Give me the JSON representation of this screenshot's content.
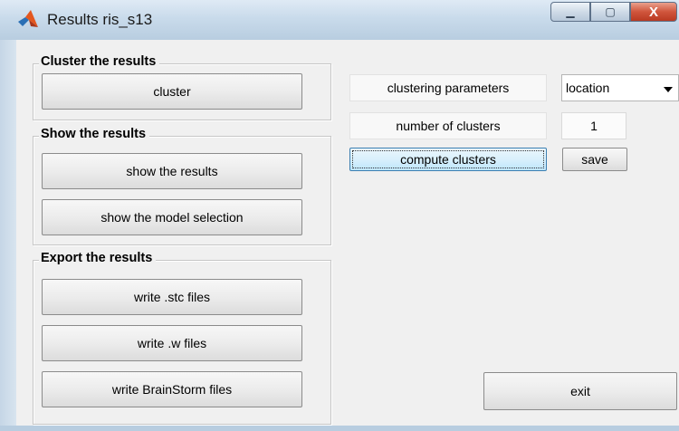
{
  "window": {
    "title": "Results  ris_s13",
    "caption": {
      "minimize": "▁",
      "maximize": "▢",
      "close": "X"
    }
  },
  "panels": {
    "cluster": {
      "title": "Cluster the results",
      "buttons": [
        "cluster"
      ]
    },
    "show": {
      "title": "Show the results",
      "buttons": [
        "show the results",
        "show the model selection"
      ]
    },
    "export": {
      "title": "Export the results",
      "buttons": [
        "write .stc files",
        "write .w files",
        "write BrainStorm files"
      ]
    }
  },
  "clustering": {
    "params_label": "clustering parameters",
    "params_value": "location",
    "num_label": "number of clusters",
    "num_value": "1",
    "compute_label": "compute clusters",
    "save_label": "save"
  },
  "exit_label": "exit",
  "icons": {
    "app": "matlab-icon",
    "dropdown": "chevron-down-icon"
  },
  "colors": {
    "titlebar": "#c9dbeb",
    "client": "#f0f0f0",
    "close_button": "#c84a31",
    "focus_button": "#bee6fd"
  }
}
